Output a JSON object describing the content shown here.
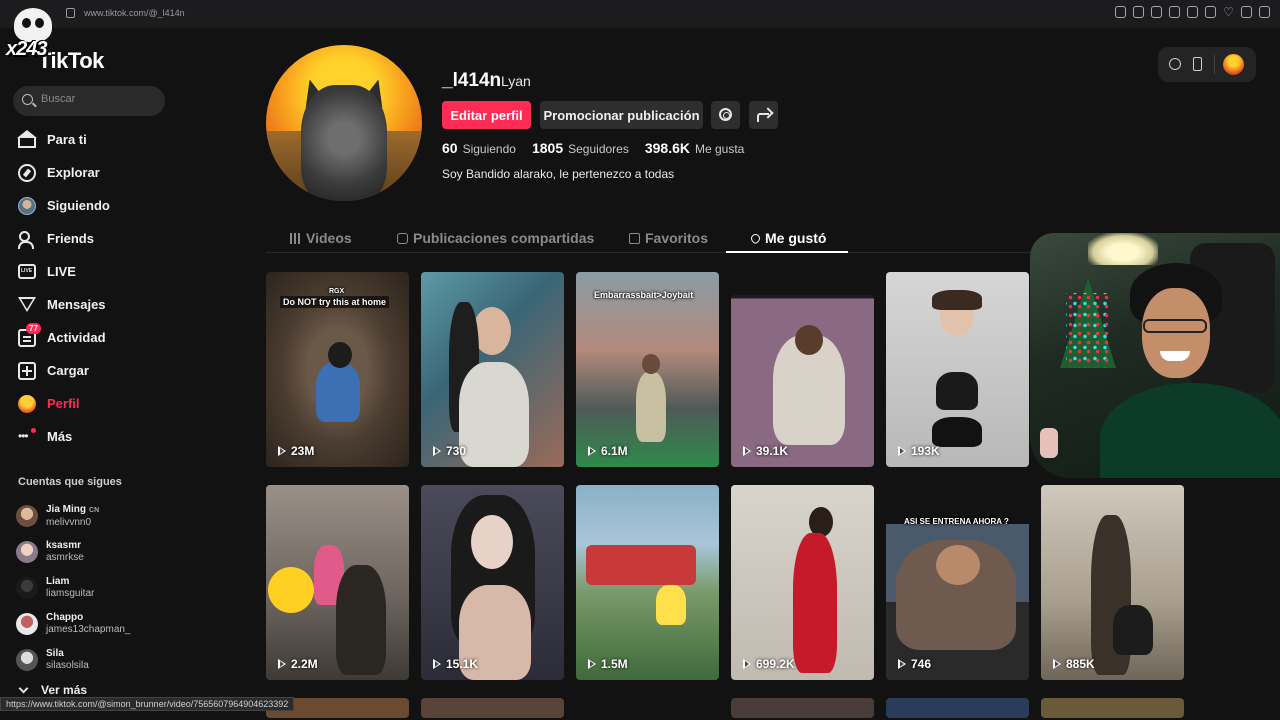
{
  "browser": {
    "url": "www.tiktok.com/@_l414n",
    "status_url": "https://www.tiktok.com/@simon_brunner/video/7565607964904623392"
  },
  "overlay": {
    "streamer_tag": "x243"
  },
  "app": {
    "brand": "TikTok"
  },
  "search": {
    "placeholder": "Buscar"
  },
  "nav": [
    {
      "label": "Para ti",
      "icon": "home-icon"
    },
    {
      "label": "Explorar",
      "icon": "compass-icon"
    },
    {
      "label": "Siguiendo",
      "icon": "following-avatar-icon"
    },
    {
      "label": "Friends",
      "icon": "friends-icon"
    },
    {
      "label": "LIVE",
      "icon": "live-icon"
    },
    {
      "label": "Mensajes",
      "icon": "inbox-icon"
    },
    {
      "label": "Actividad",
      "icon": "activity-icon",
      "badge": "77"
    },
    {
      "label": "Cargar",
      "icon": "upload-icon"
    },
    {
      "label": "Perfil",
      "icon": "profile-avatar-icon",
      "active": true
    },
    {
      "label": "Más",
      "icon": "more-icon"
    }
  ],
  "following": {
    "heading": "Cuentas que sigues",
    "accounts": [
      {
        "name": "Jia Ming",
        "tag": "CN",
        "handle": "melivvnn0"
      },
      {
        "name": "ksasmr",
        "handle": "asmrkse"
      },
      {
        "name": "Liam",
        "handle": "liamsguitar"
      },
      {
        "name": "Chappo",
        "handle": "james13chapman_"
      },
      {
        "name": "Sila",
        "handle": "silasolsila"
      }
    ],
    "see_more": "Ver más"
  },
  "profile": {
    "username": "_l414n",
    "display_name": "Lyan",
    "edit_button": "Editar perfil",
    "promote_button": "Promocionar publicación",
    "stats": {
      "following_count": "60",
      "following_label": "Siguiendo",
      "followers_count": "1805",
      "followers_label": "Seguidores",
      "likes_count": "398.6K",
      "likes_label": "Me gusta"
    },
    "bio": "Soy Bandido alarako, le pertenezco a todas"
  },
  "tabs": {
    "videos": "Videos",
    "reposts": "Publicaciones compartidas",
    "favorites": "Favoritos",
    "liked": "Me gustó"
  },
  "videos": [
    {
      "views": "23M",
      "caption": "Do NOT try this at home",
      "caption_top": "RGX"
    },
    {
      "views": "730"
    },
    {
      "views": "6.1M",
      "caption": "Embarrassbait>Joybait"
    },
    {
      "views": "39.1K"
    },
    {
      "views": "193K"
    },
    {
      "views": "2.2M"
    },
    {
      "views": "15.1K"
    },
    {
      "views": "1.5M"
    },
    {
      "views": "699.2K"
    },
    {
      "views": "746",
      "caption": "ASI SE ENTRENA AHORA ?"
    },
    {
      "views": "885K"
    }
  ],
  "colors": {
    "accent": "#fe2c55",
    "bg": "#121212"
  }
}
